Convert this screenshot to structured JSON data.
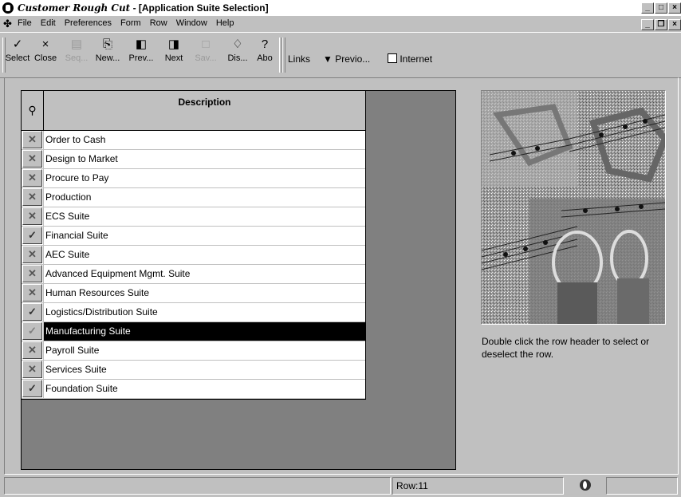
{
  "window": {
    "app_name": "Customer Rough Cut",
    "title_rest": " - [Application Suite Selection]"
  },
  "menu": [
    "File",
    "Edit",
    "Preferences",
    "Form",
    "Row",
    "Window",
    "Help"
  ],
  "toolbar": {
    "select": "Select",
    "close": "Close",
    "seq": "Seq...",
    "new": "New...",
    "prev": "Prev...",
    "next": "Next",
    "save": "Sav...",
    "display": "Dis...",
    "about": "Abo",
    "links": "Links",
    "previous": "Previo...",
    "internet": "Internet"
  },
  "grid": {
    "header": "Description",
    "rows": [
      {
        "label": "Order to Cash",
        "state": "x"
      },
      {
        "label": "Design to Market",
        "state": "x"
      },
      {
        "label": "Procure to Pay",
        "state": "x"
      },
      {
        "label": "Production",
        "state": "x"
      },
      {
        "label": "ECS Suite",
        "state": "x"
      },
      {
        "label": "Financial Suite",
        "state": "check"
      },
      {
        "label": "AEC Suite",
        "state": "x"
      },
      {
        "label": "Advanced Equipment Mgmt. Suite",
        "state": "x"
      },
      {
        "label": "Human Resources Suite",
        "state": "x"
      },
      {
        "label": "Logistics/Distribution Suite",
        "state": "check"
      },
      {
        "label": "Manufacturing Suite",
        "state": "check"
      },
      {
        "label": "Payroll Suite",
        "state": "x"
      },
      {
        "label": "Services Suite",
        "state": "x"
      },
      {
        "label": "Foundation Suite",
        "state": "check"
      }
    ],
    "selected_index": 10
  },
  "hint": "Double click the row header to select or deselect the row.",
  "status": {
    "row": "Row:11"
  }
}
